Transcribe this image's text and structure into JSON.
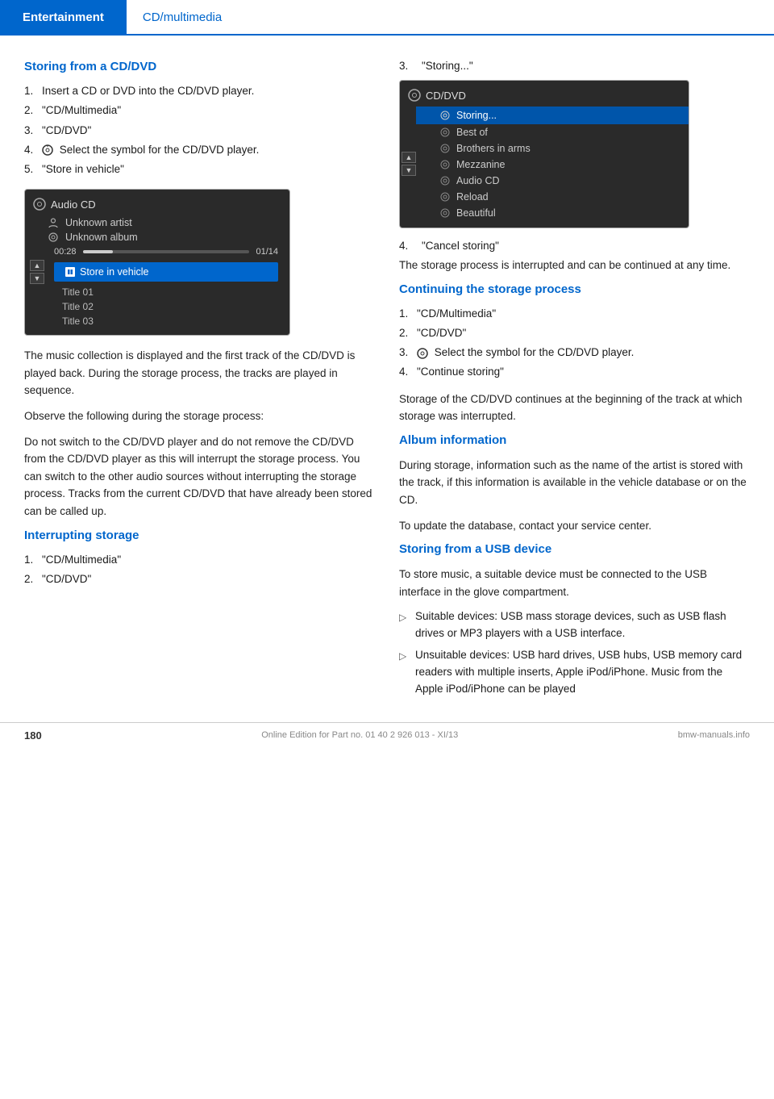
{
  "header": {
    "entertainment_label": "Entertainment",
    "cd_label": "CD/multimedia"
  },
  "left": {
    "section1_heading": "Storing from a CD/DVD",
    "steps": [
      {
        "num": "1.",
        "text": "Insert a CD or DVD into the CD/DVD player."
      },
      {
        "num": "2.",
        "text": "\"CD/Multimedia\""
      },
      {
        "num": "3.",
        "text": "\"CD/DVD\""
      },
      {
        "num": "4.",
        "text": "Select the symbol for the CD/DVD player."
      },
      {
        "num": "5.",
        "text": "\"Store in vehicle\""
      }
    ],
    "screen_title": "Audio CD",
    "screen_artist": "Unknown artist",
    "screen_album": "Unknown album",
    "screen_time": "00:28",
    "screen_track": "01/14",
    "screen_store_btn": "Store in vehicle",
    "screen_title01": "Title   01",
    "screen_title02": "Title   02",
    "screen_title03": "Title   03",
    "para1": "The music collection is displayed and the first track of the CD/DVD is played back. During the storage process, the tracks are played in sequence.",
    "para2": "Observe the following during the storage process:",
    "para3": "Do not switch to the CD/DVD player and do not remove the CD/DVD from the CD/DVD player as this will interrupt the storage process. You can switch to the other audio sources without interrupting the storage process. Tracks from the current CD/DVD that have already been stored can be called up.",
    "interrupting_heading": "Interrupting storage",
    "interrupting_steps": [
      {
        "num": "1.",
        "text": "\"CD/Multimedia\""
      },
      {
        "num": "2.",
        "text": "\"CD/DVD\""
      }
    ]
  },
  "right": {
    "step3_label": "3.",
    "step3_text": "\"Storing...\"",
    "screen2_title": "CD/DVD",
    "screen2_items": [
      {
        "label": "Storing...",
        "highlighted": true
      },
      {
        "label": "Best of",
        "highlighted": false
      },
      {
        "label": "Brothers in arms",
        "highlighted": false
      },
      {
        "label": "Mezzanine",
        "highlighted": false
      },
      {
        "label": "Audio CD",
        "highlighted": false
      },
      {
        "label": "Reload",
        "highlighted": false
      },
      {
        "label": "Beautiful",
        "highlighted": false
      }
    ],
    "step4_label": "4.",
    "step4_text": "\"Cancel storing\"",
    "para_cancel": "The storage process is interrupted and can be continued at any time.",
    "continuing_heading": "Continuing the storage process",
    "continuing_steps": [
      {
        "num": "1.",
        "text": "\"CD/Multimedia\""
      },
      {
        "num": "2.",
        "text": "\"CD/DVD\""
      },
      {
        "num": "3.",
        "text": "Select the symbol for the CD/DVD player."
      },
      {
        "num": "4.",
        "text": "\"Continue storing\""
      }
    ],
    "para_continue": "Storage of the CD/DVD continues at the beginning of the track at which storage was interrupted.",
    "album_heading": "Album information",
    "para_album1": "During storage, information such as the name of the artist is stored with the track, if this information is available in the vehicle database or on the CD.",
    "para_album2": "To update the database, contact your service center.",
    "usb_heading": "Storing from a USB device",
    "para_usb": "To store music, a suitable device must be connected to the USB interface in the glove compartment.",
    "bullet_items": [
      "Suitable devices: USB mass storage devices, such as USB flash drives or MP3 players with a USB interface.",
      "Unsuitable devices: USB hard drives, USB hubs, USB memory card readers with multiple inserts, Apple iPod/iPhone. Music from the Apple iPod/iPhone can be played"
    ]
  },
  "footer": {
    "page_num": "180",
    "footer_text": "Online Edition for Part no. 01 40 2 926 013 - XI/13"
  }
}
